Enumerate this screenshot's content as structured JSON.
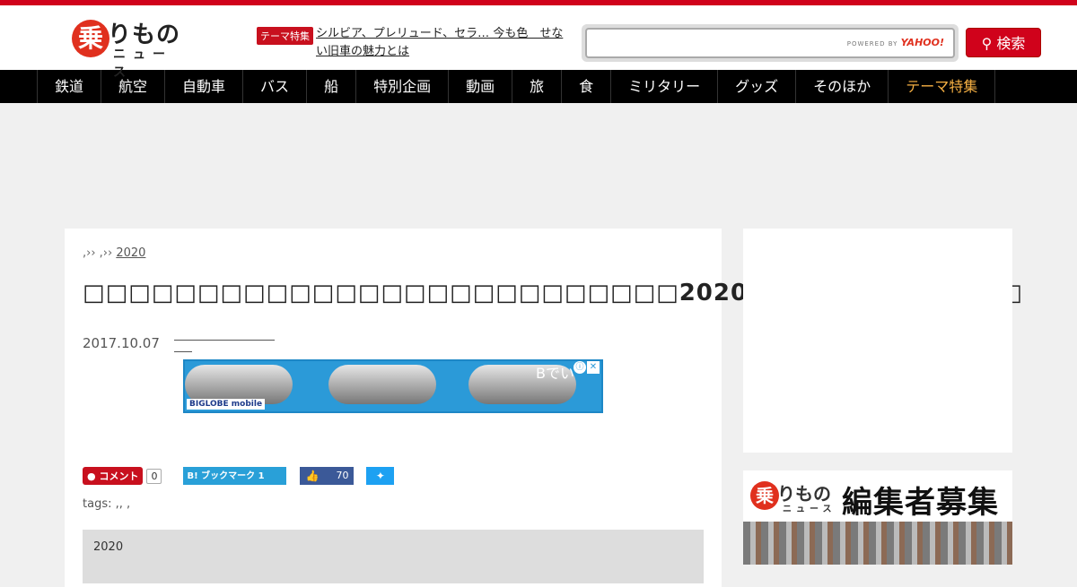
{
  "header": {
    "logo_main": "りもの",
    "logo_char": "乗",
    "logo_sub": "ニュース",
    "theme_badge": "テーマ特集",
    "theme_link": "シルビア、プレリュード、セラ… 今も色　せない旧車の魅力とは",
    "search_placeholder": "",
    "powered_by": "POWERED BY",
    "powered_brand": "YAHOO!",
    "search_button": "検索"
  },
  "nav": {
    "items": [
      "鉄道",
      "航空",
      "自動車",
      "バス",
      "船",
      "特別企画",
      "動画",
      "旅",
      "食",
      "ミリタリー",
      "グッズ",
      "そのほか",
      "テーマ特集"
    ]
  },
  "article": {
    "breadcrumb_prefix": ",›› ,›› ",
    "breadcrumb_year": "2020",
    "title": "□□□□□□□□□□□□□□□□□□□□□□□□□□2020□□□□□□□□□□□□",
    "date": "2017.10.07",
    "banner_text": "Bでい",
    "banner_logo": "BIGLOBE mobile",
    "banner_info": "ⓘ",
    "banner_close": "✕",
    "comment_label": "コメント",
    "comment_count": "0",
    "hatena_label": "B! ブックマーク 1",
    "fb_count": "70",
    "tags": "tags: ,, ,",
    "related_label": "2020"
  },
  "sidebar": {
    "recruit_char": "乗",
    "recruit_logo": "りもの",
    "recruit_logo_sub": "ニュース",
    "recruit_head": "編集者募集"
  },
  "colors": {
    "brand_red": "#d0021b",
    "nav_bg": "#000000",
    "nav_special": "#f6b043"
  }
}
